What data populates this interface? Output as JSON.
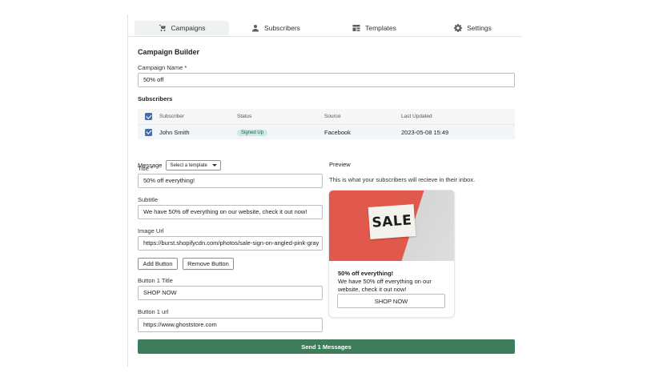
{
  "tabs": [
    {
      "label": "Campaigns",
      "icon": "shop-icon",
      "active": true
    },
    {
      "label": "Subscribers",
      "icon": "person-icon",
      "active": false
    },
    {
      "label": "Templates",
      "icon": "template-icon",
      "active": false
    },
    {
      "label": "Settings",
      "icon": "gear-icon",
      "active": false
    }
  ],
  "builder": {
    "title": "Campaign Builder",
    "campaign_name_label": "Campaign Name *",
    "campaign_name_value": "50% off",
    "subscribers_label": "Subscribers"
  },
  "table": {
    "headers": [
      "Subscriber",
      "Status",
      "Source",
      "Last Updated"
    ],
    "rows": [
      {
        "subscriber": "John Smith",
        "status": "Signed Up",
        "source": "Facebook",
        "last_updated": "2023-05-08 15:49"
      }
    ]
  },
  "message": {
    "label": "Message",
    "template_select": "Select a template",
    "title_label": "Title *",
    "title_value": "50% off everything!",
    "subtitle_label": "Subtitle",
    "subtitle_value": "We have 50% off everything on our website, check it out now!",
    "image_url_label": "Image Url",
    "image_url_value": "https://burst.shopifycdn.com/photos/sale-sign-on-angled-pink-gray",
    "add_button": "Add Button",
    "remove_button": "Remove Button",
    "button1_title_label": "Button 1 Title",
    "button1_title_value": "SHOP NOW",
    "button1_url_label": "Button 1 url",
    "button1_url_value": "https://www.ghoststore.com"
  },
  "preview": {
    "label": "Preview",
    "description": "This is what your subscribers will recieve in their inbox.",
    "image_text": "SALE",
    "card_title": "50% off everything!",
    "card_subtitle": "We have 50% off everything on our website, check it out now!",
    "card_button": "SHOP NOW"
  },
  "send_button": "Send 1 Messages",
  "colors": {
    "accent": "#3e7d5c",
    "checkbox": "#3d6fb6",
    "badge_bg": "#cde9e1"
  }
}
